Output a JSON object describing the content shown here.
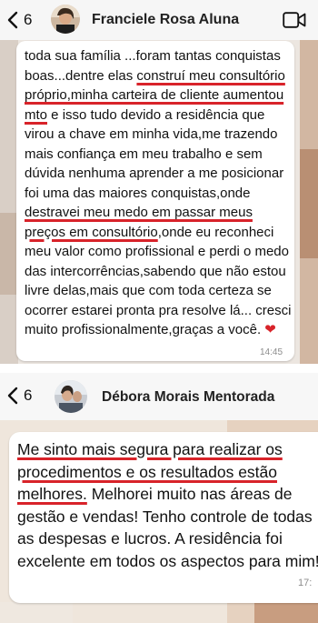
{
  "screen1": {
    "header": {
      "back_count": "6",
      "contact_name": "Franciele Rosa Aluna"
    },
    "message": {
      "parts": [
        {
          "text": "toda sua família  ...foram tantas conquistas boas...dentre elas ",
          "underline": false
        },
        {
          "text": "construí meu consultório próprio,minha carteira de cliente aumentou mto",
          "underline": true
        },
        {
          "text": " e isso tudo devido a residência que virou a chave em minha vida,me trazendo mais confiança em meu trabalho e sem dúvida nenhuma aprender a me posicionar foi uma das maiores conquistas,onde ",
          "underline": false
        },
        {
          "text": "destravei meu medo em passar meus preços em consultório",
          "underline": true
        },
        {
          "text": ",onde eu reconheci meu valor como profissional e perdi o medo das intercorrências,sabendo que não estou livre delas,mais que com toda certeza se ocorrer estarei pronta pra resolve lá... cresci muito profissionalmente,graças a você. ",
          "underline": false
        }
      ],
      "emoji": "❤",
      "time": "14:45"
    }
  },
  "screen2": {
    "header": {
      "back_count": "6",
      "contact_name": "Débora Morais Mentorada"
    },
    "message": {
      "parts": [
        {
          "text": "Me sinto mais segura para realizar os procedimentos e os resultados estão melhores.",
          "underline": true
        },
        {
          "text": " Melhorei muito nas áreas de gestão e vendas! Tenho controle de todas as despesas e lucros. A residência foi excelente em todos os aspectos para mim!",
          "underline": false
        }
      ],
      "time": "17:"
    }
  },
  "colors": {
    "underline": "#d8232a",
    "header_bg": "#f6f6f6",
    "bubble_bg": "#ffffff"
  },
  "icons": [
    "chevron-left-icon",
    "video-camera-icon",
    "heart-emoji"
  ]
}
